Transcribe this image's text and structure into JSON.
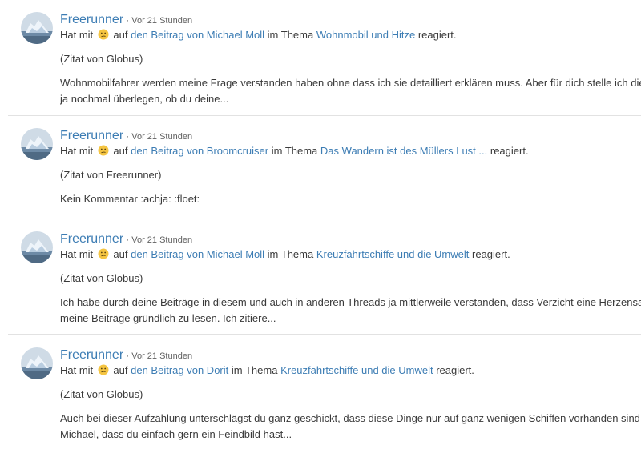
{
  "entries": [
    {
      "user": "Freerunner",
      "time": "· Vor 21 Stunden",
      "reaction": {
        "prefix": "Hat mit",
        "mid": "auf",
        "post_link": "den Beitrag von Michael Moll",
        "thema_label": "im Thema",
        "thread_link": "Wohnmobil und Hitze",
        "suffix": "reagiert."
      },
      "quote": "(Zitat von Globus)",
      "text_lines": [
        "Wohnmobilfahrer werden meine Frage verstanden haben ohne dass ich sie detailliert erklären muss. Aber für dich stelle ich die Frage ge",
        "ja nochmal überlegen, ob du deine..."
      ]
    },
    {
      "user": "Freerunner",
      "time": "· Vor 21 Stunden",
      "reaction": {
        "prefix": "Hat mit",
        "mid": "auf",
        "post_link": "den Beitrag von Broomcruiser",
        "thema_label": "im Thema",
        "thread_link": "Das Wandern ist des Müllers Lust ...",
        "suffix": "reagiert."
      },
      "quote": "(Zitat von Freerunner)",
      "text_lines": [
        "Kein Kommentar :achja: :floet:"
      ]
    },
    {
      "user": "Freerunner",
      "time": "· Vor 21 Stunden",
      "reaction": {
        "prefix": "Hat mit",
        "mid": "auf",
        "post_link": "den Beitrag von Michael Moll",
        "thema_label": "im Thema",
        "thread_link": "Kreuzfahrtschiffe und die Umwelt",
        "suffix": "reagiert."
      },
      "quote": "(Zitat von Globus)",
      "text_lines": [
        "Ich habe durch deine Beiträge in diesem und auch in anderen Threads ja mittlerweile verstanden, dass Verzicht eine Herzensangelegenh",
        "meine Beiträge gründlich zu lesen. Ich zitiere..."
      ]
    },
    {
      "user": "Freerunner",
      "time": "· Vor 21 Stunden",
      "reaction": {
        "prefix": "Hat mit",
        "mid": "auf",
        "post_link": "den Beitrag von Dorit",
        "thema_label": "im Thema",
        "thread_link": "Kreuzfahrtschiffe und die Umwelt",
        "suffix": "reagiert."
      },
      "quote": "(Zitat von Globus)",
      "text_lines": [
        "Auch bei dieser Aufzählung unterschlägst du ganz geschickt, dass diese Dinge nur auf ganz wenigen Schiffen vorhanden sind. Standard i",
        "Michael, dass du einfach gern ein Feindbild hast..."
      ]
    }
  ],
  "icons": {
    "avatar": "iceberg-avatar-icon",
    "reaction": "confused-face-emoji-icon"
  },
  "colors": {
    "link": "#3d7db4",
    "text": "#3a3a3a",
    "divider": "#e2e2e2",
    "emoji": "#f5c542"
  }
}
